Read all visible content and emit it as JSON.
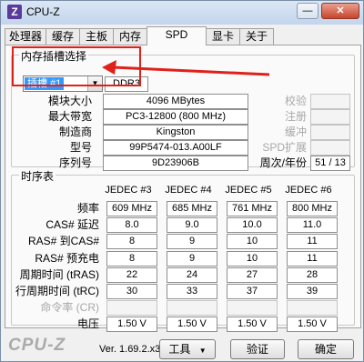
{
  "window": {
    "title": "CPU-Z",
    "icon_letter": "Z",
    "minimize": "—",
    "close": "✕"
  },
  "tabs": [
    "处理器",
    "缓存",
    "主板",
    "内存",
    "SPD",
    "显卡",
    "关于"
  ],
  "active_tab": "SPD",
  "slot": {
    "group_label": "内存插槽选择",
    "selected": "插槽 #1",
    "type": "DDR3",
    "fields": [
      {
        "label": "模块大小",
        "value": "4096 MBytes"
      },
      {
        "label": "最大带宽",
        "value": "PC3-12800 (800 MHz)"
      },
      {
        "label": "制造商",
        "value": "Kingston"
      },
      {
        "label": "型号",
        "value": "99P5474-013.A00LF"
      },
      {
        "label": "序列号",
        "value": "9D23906B"
      }
    ],
    "right_fields": [
      {
        "label": "校验",
        "value": ""
      },
      {
        "label": "注册",
        "value": ""
      },
      {
        "label": "缓冲",
        "value": ""
      },
      {
        "label": "SPD扩展",
        "value": ""
      }
    ],
    "week_year_label": "周次/年份",
    "week_year_value": "51 / 13"
  },
  "timings": {
    "group_label": "时序表",
    "columns": [
      "JEDEC #3",
      "JEDEC #4",
      "JEDEC #5",
      "JEDEC #6"
    ],
    "rows": [
      {
        "label": "频率",
        "values": [
          "609 MHz",
          "685 MHz",
          "761 MHz",
          "800 MHz"
        ]
      },
      {
        "label": "CAS# 延迟",
        "values": [
          "8.0",
          "9.0",
          "10.0",
          "11.0"
        ]
      },
      {
        "label": "RAS# 到CAS#",
        "values": [
          "8",
          "9",
          "10",
          "11"
        ]
      },
      {
        "label": "RAS# 预充电",
        "values": [
          "8",
          "9",
          "10",
          "11"
        ]
      },
      {
        "label": "周期时间 (tRAS)",
        "values": [
          "22",
          "24",
          "27",
          "28"
        ]
      },
      {
        "label": "行周期时间 (tRC)",
        "values": [
          "30",
          "33",
          "37",
          "39"
        ]
      },
      {
        "label": "命令率 (CR)",
        "values": [
          "",
          "",
          "",
          ""
        ]
      },
      {
        "label": "电压",
        "values": [
          "1.50 V",
          "1.50 V",
          "1.50 V",
          "1.50 V"
        ]
      }
    ]
  },
  "footer": {
    "brand": "CPU-Z",
    "version": "Ver. 1.69.2.x32",
    "tools_label": "工具",
    "validate_label": "验证",
    "ok_label": "确定"
  },
  "annotation": {
    "box_color": "#e0201a"
  }
}
